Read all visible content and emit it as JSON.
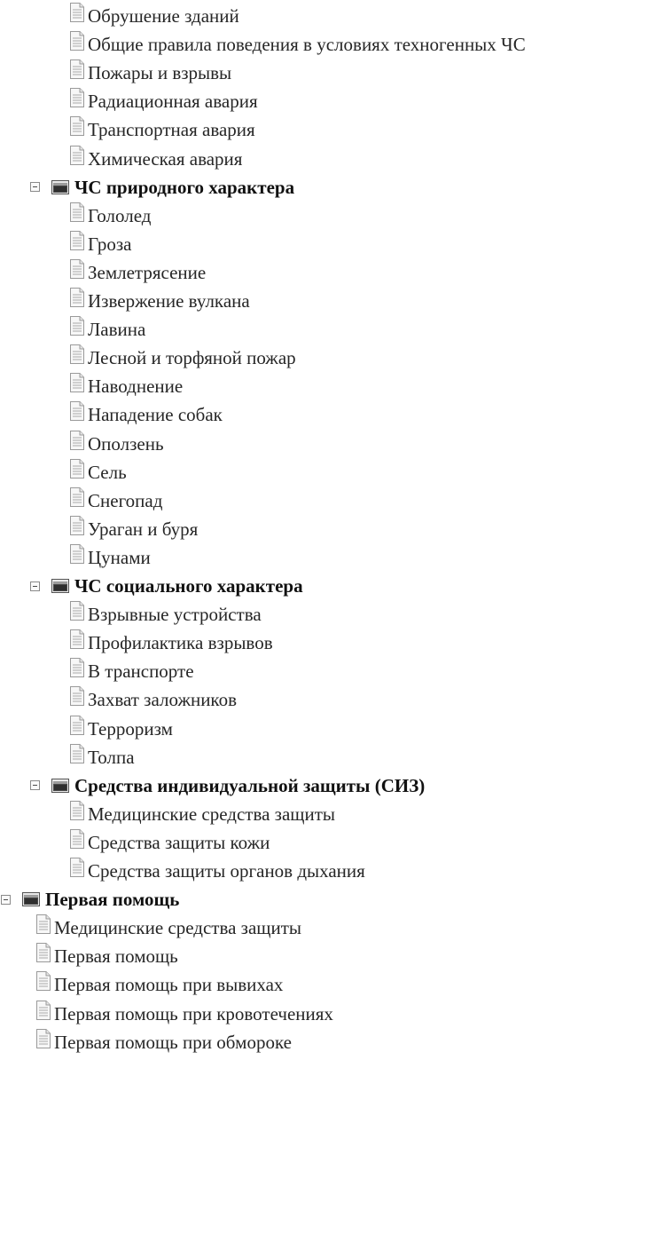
{
  "tree": [
    {
      "type": "leaf",
      "level": 2,
      "label": "Обрушение зданий"
    },
    {
      "type": "leaf",
      "level": 2,
      "label": "Общие правила поведения в условиях техногенных ЧС"
    },
    {
      "type": "leaf",
      "level": 2,
      "label": "Пожары и взрывы"
    },
    {
      "type": "leaf",
      "level": 2,
      "label": "Радиационная авария"
    },
    {
      "type": "leaf",
      "level": 2,
      "label": "Транспортная авария"
    },
    {
      "type": "leaf",
      "level": 2,
      "label": "Химическая авария"
    },
    {
      "type": "folder",
      "level": 1,
      "expanded": true,
      "label": "ЧС природного характера"
    },
    {
      "type": "leaf",
      "level": 2,
      "label": "Гололед"
    },
    {
      "type": "leaf",
      "level": 2,
      "label": "Гроза"
    },
    {
      "type": "leaf",
      "level": 2,
      "label": "Землетрясение"
    },
    {
      "type": "leaf",
      "level": 2,
      "label": "Извержение вулкана"
    },
    {
      "type": "leaf",
      "level": 2,
      "label": "Лавина"
    },
    {
      "type": "leaf",
      "level": 2,
      "label": "Лесной и торфяной пожар"
    },
    {
      "type": "leaf",
      "level": 2,
      "label": "Наводнение"
    },
    {
      "type": "leaf",
      "level": 2,
      "label": "Нападение собак"
    },
    {
      "type": "leaf",
      "level": 2,
      "label": "Оползень"
    },
    {
      "type": "leaf",
      "level": 2,
      "label": "Сель"
    },
    {
      "type": "leaf",
      "level": 2,
      "label": "Снегопад"
    },
    {
      "type": "leaf",
      "level": 2,
      "label": "Ураган и буря"
    },
    {
      "type": "leaf",
      "level": 2,
      "label": "Цунами"
    },
    {
      "type": "folder",
      "level": 1,
      "expanded": true,
      "label": "ЧС социального характера"
    },
    {
      "type": "leaf",
      "level": 2,
      "label": "Взрывные устройства"
    },
    {
      "type": "leaf",
      "level": 2,
      "label": "Профилактика взрывов"
    },
    {
      "type": "leaf",
      "level": 2,
      "label": "В транспорте"
    },
    {
      "type": "leaf",
      "level": 2,
      "label": "Захват заложников"
    },
    {
      "type": "leaf",
      "level": 2,
      "label": "Терроризм"
    },
    {
      "type": "leaf",
      "level": 2,
      "label": "Толпа"
    },
    {
      "type": "folder",
      "level": 1,
      "expanded": true,
      "label": "Средства индивидуальной защиты (СИЗ)"
    },
    {
      "type": "leaf",
      "level": 2,
      "label": "Медицинские средства защиты"
    },
    {
      "type": "leaf",
      "level": 2,
      "label": "Средства защиты кожи"
    },
    {
      "type": "leaf",
      "level": 2,
      "label": "Средства защиты органов дыхания"
    },
    {
      "type": "folder",
      "level": 0,
      "expanded": true,
      "label": "Первая помощь"
    },
    {
      "type": "leaf",
      "level": 1,
      "label": "Медицинские средства защиты"
    },
    {
      "type": "leaf",
      "level": 1,
      "label": "Первая помощь"
    },
    {
      "type": "leaf",
      "level": 1,
      "label": "Первая помощь при вывихах"
    },
    {
      "type": "leaf",
      "level": 1,
      "label": "Первая помощь при кровотечениях"
    },
    {
      "type": "leaf",
      "level": 1,
      "label": "Первая помощь при обмороке"
    }
  ],
  "icons": {
    "leaf": "document-icon",
    "folder": "folder-icon",
    "toggle": "collapse-toggle-icon"
  },
  "colors": {
    "text": "#262626",
    "folder_text": "#111111",
    "icon_border": "#9a9a9a"
  }
}
